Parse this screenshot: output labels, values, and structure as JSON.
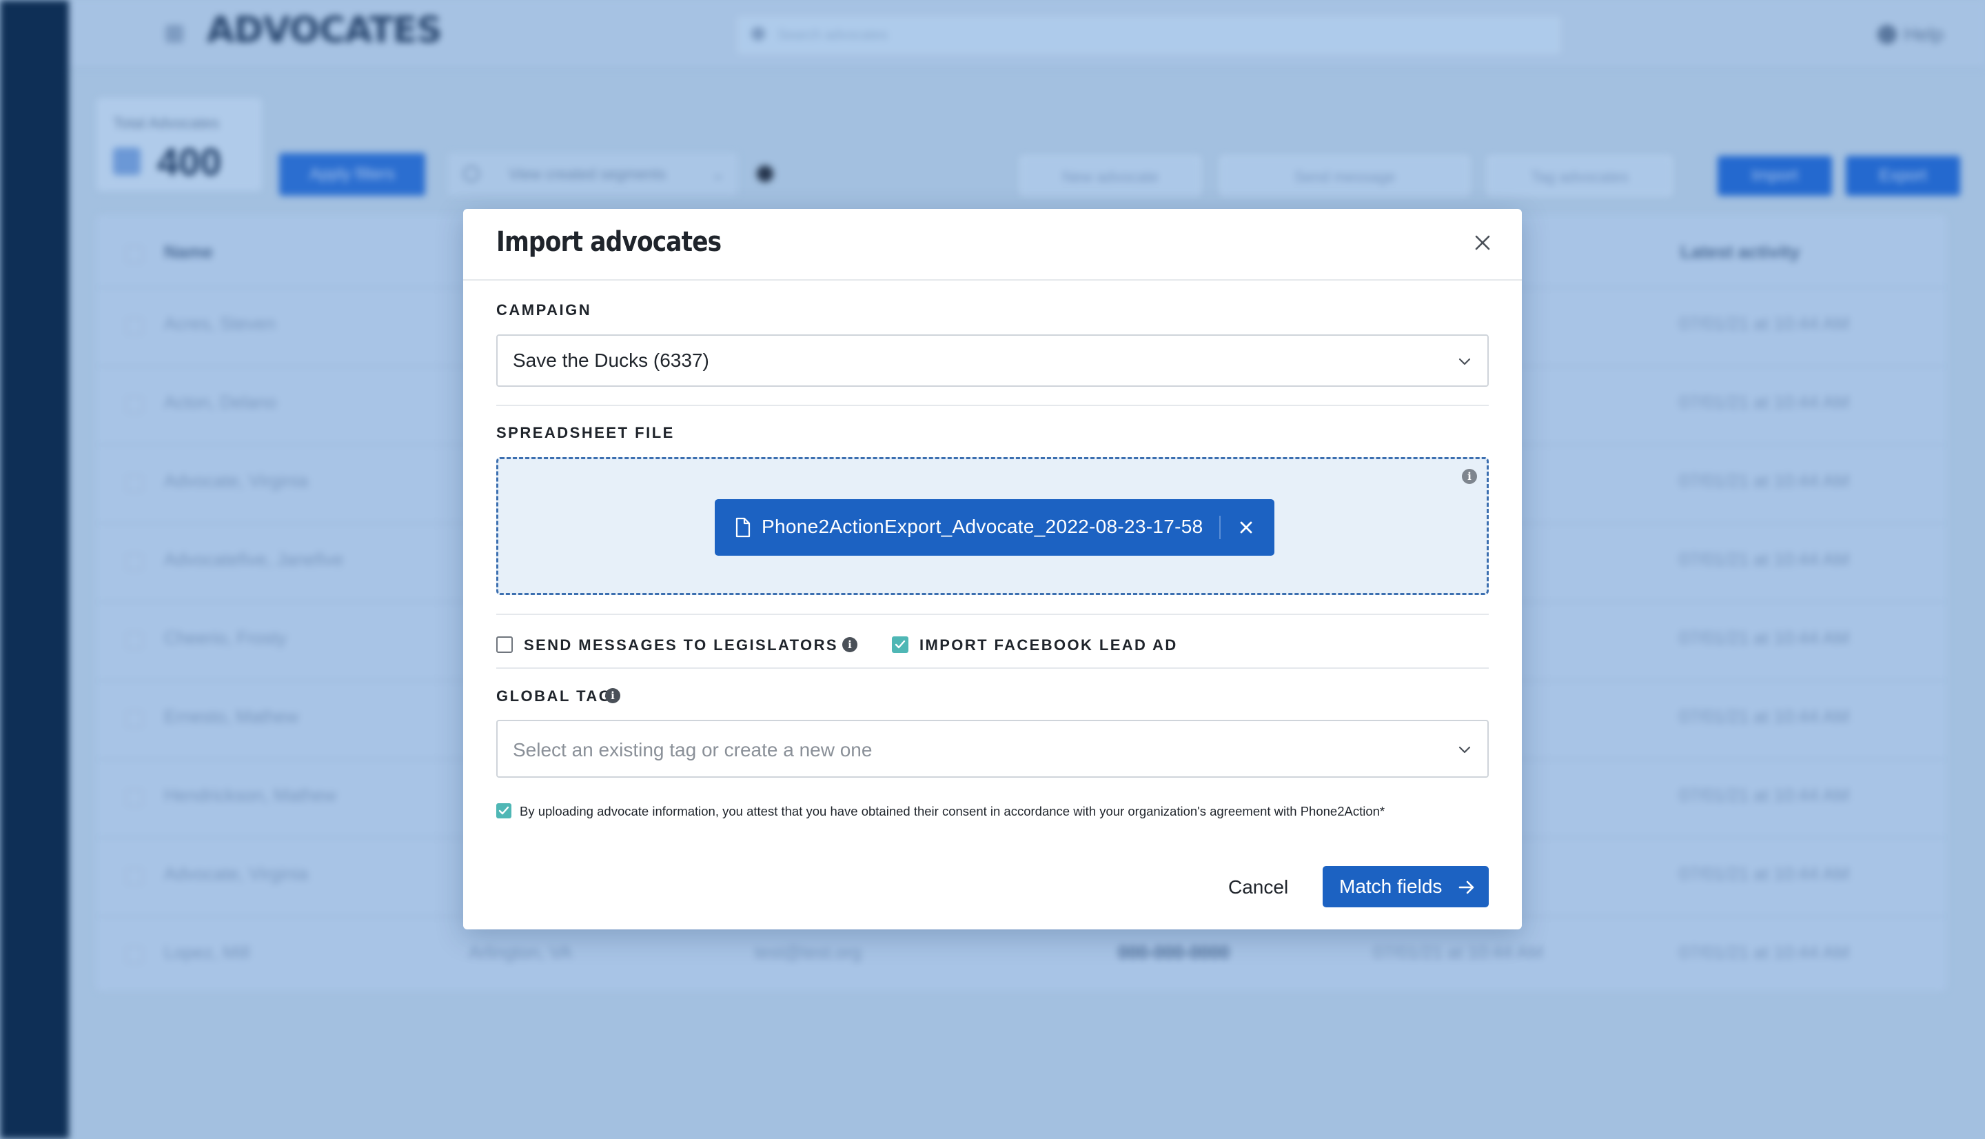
{
  "background": {
    "app_title": "ADVOCATES",
    "search_placeholder": "Search advocates",
    "help_label": "Help",
    "total_label": "Total Advocates",
    "total_count": "400",
    "apply_filters_label": "Apply filters",
    "segments_placeholder": "View created segments",
    "new_advocate_label": "New advocate",
    "send_message_label": "Send message",
    "tag_advocates_label": "Tag advocates",
    "import_label": "Import",
    "export_label": "Export",
    "table": {
      "columns": [
        "Name",
        "Latest activity"
      ],
      "rows": [
        {
          "name": "Acres, Steven",
          "latest": "07/01/21 at 10:44 AM"
        },
        {
          "name": "Acton, Delano",
          "latest": "07/01/21 at 10:44 AM"
        },
        {
          "name": "Advocate, Virginia",
          "latest": "07/01/21 at 10:44 AM"
        },
        {
          "name": "Advocatefive, Janefive",
          "latest": "07/01/21 at 10:44 AM"
        },
        {
          "name": "Cheerio, Frosty",
          "latest": "07/01/21 at 10:44 AM"
        },
        {
          "name": "Ernesto, Mathew",
          "latest": "07/01/21 at 10:44 AM"
        },
        {
          "name": "Hendrickson, Mathew",
          "latest": "07/01/21 at 10:44 AM"
        },
        {
          "name": "Advocate, Virginia",
          "latest": "07/01/21 at 10:44 AM"
        },
        {
          "name": "Lopez, Mill",
          "location": "Arlington, VA",
          "email": "test@test.org",
          "phone": "000-000-0000",
          "created": "07/01/21 at 10:44 AM",
          "latest": "07/01/21 at 10:44 AM"
        }
      ]
    }
  },
  "modal": {
    "title": "Import advocates",
    "campaign_label": "CAMPAIGN",
    "campaign_value": "Save the Ducks (6337)",
    "spreadsheet_label": "SPREADSHEET FILE",
    "file_name": "Phone2ActionExport_Advocate_2022-08-23-17-58",
    "send_messages_label": "SEND MESSAGES TO LEGISLATORS",
    "send_messages_checked": false,
    "import_fb_label": "IMPORT FACEBOOK LEAD AD",
    "import_fb_checked": true,
    "global_tag_label": "GLOBAL TAG",
    "global_tag_placeholder": "Select an existing tag or create a new one",
    "consent_text": "By uploading advocate information, you attest that you have obtained their consent in accordance with your organization's agreement with Phone2Action*",
    "consent_checked": true,
    "cancel_label": "Cancel",
    "match_fields_label": "Match fields"
  },
  "colors": {
    "primary": "#1c62c2",
    "checkbox_teal": "#4fb7b5",
    "dropzone_bg": "#e7f0f9",
    "dropzone_border": "#3c6fb0",
    "overlay": "#a3c0e0",
    "sidebar": "#0e2f56"
  },
  "icons": [
    "close-icon",
    "chevron-down-icon",
    "info-icon",
    "file-icon",
    "remove-file-icon",
    "checkmark-icon",
    "arrow-right-icon"
  ]
}
